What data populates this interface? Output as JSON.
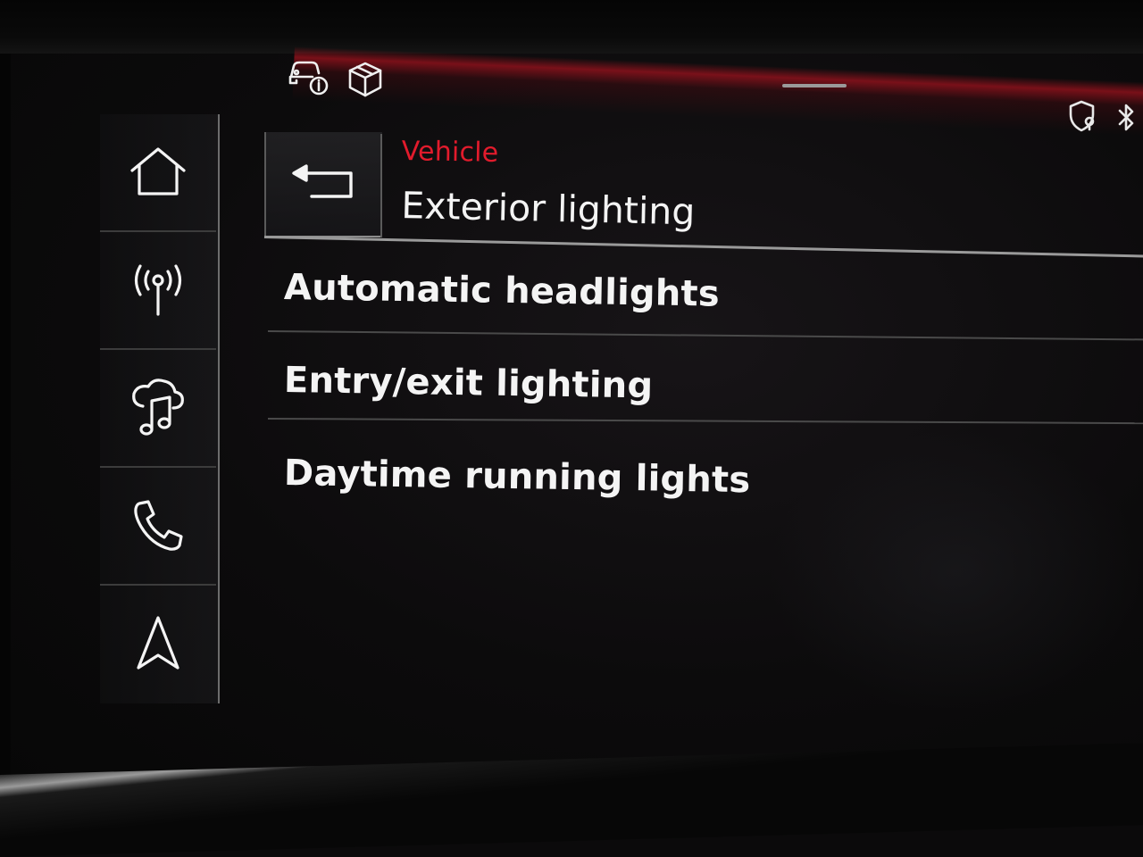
{
  "header": {
    "breadcrumb": "Vehicle",
    "title": "Exterior lighting",
    "accent_color": "#e21b2c"
  },
  "top_bar": {
    "icons": [
      "vehicle-info-icon",
      "box-icon"
    ],
    "status_icons": [
      "shield-location-icon",
      "bluetooth-icon"
    ]
  },
  "sidebar": {
    "items": [
      {
        "icon": "home-icon"
      },
      {
        "icon": "radio-icon"
      },
      {
        "icon": "media-icon"
      },
      {
        "icon": "phone-icon"
      },
      {
        "icon": "navigation-icon"
      }
    ]
  },
  "menu": {
    "items": [
      {
        "label": "Automatic headlights"
      },
      {
        "label": "Entry/exit lighting"
      },
      {
        "label": "Daytime running lights"
      }
    ]
  }
}
